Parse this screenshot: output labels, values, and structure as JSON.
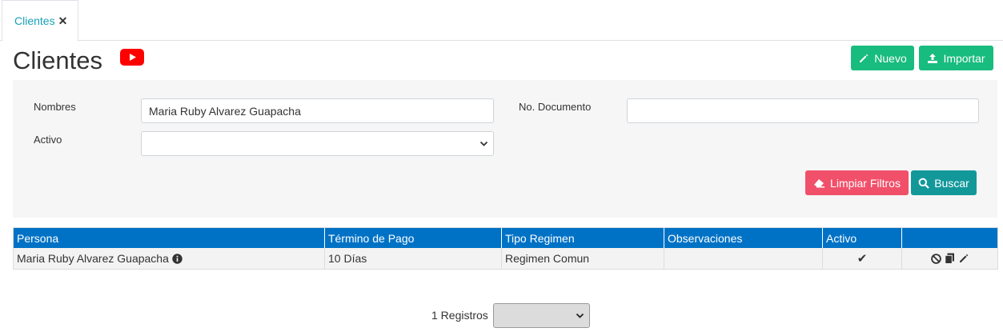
{
  "tab": {
    "label": "Clientes",
    "close": "✕"
  },
  "page": {
    "title": "Clientes"
  },
  "actions": {
    "nuevo_label": "Nuevo",
    "importar_label": "Importar"
  },
  "filters": {
    "nombres_label": "Nombres",
    "nombres_value": "Maria Ruby Alvarez Guapacha",
    "documento_label": "No. Documento",
    "documento_value": "",
    "activo_label": "Activo",
    "activo_value": "",
    "limpiar_label": "Limpiar Filtros",
    "buscar_label": "Buscar"
  },
  "table": {
    "headers": [
      "Persona",
      "Término de Pago",
      "Tipo Regimen",
      "Observaciones",
      "Activo",
      ""
    ],
    "rows": [
      {
        "persona": "Maria Ruby Alvarez Guapacha",
        "termino": "10 Días",
        "regimen": "Regimen Comun",
        "observaciones": "",
        "activo": "✔"
      }
    ]
  },
  "pager": {
    "count_text": "1 Registros",
    "page_size_value": ""
  },
  "colors": {
    "accent_green": "#18bc7e",
    "header_blue": "#0072c6",
    "danger": "#f1506a",
    "teal": "#13989a",
    "tab_text": "#17a2b8"
  }
}
